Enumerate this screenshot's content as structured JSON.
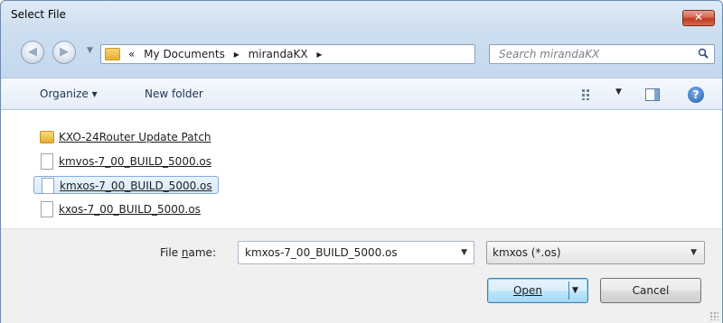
{
  "window": {
    "title": "Select File",
    "close_label": "✕"
  },
  "address_bar": {
    "overflow": "«",
    "crumbs": [
      "My Documents",
      "mirandaKX"
    ],
    "separator": "▸"
  },
  "search": {
    "placeholder": "Search mirandaKX"
  },
  "toolbar": {
    "organize_label": "Organize ▾",
    "new_folder_label": "New folder"
  },
  "files": [
    {
      "name": "KXO-24Router Update Patch",
      "type": "folder",
      "selected": false
    },
    {
      "name": "kmvos-7_00_BUILD_5000.os",
      "type": "file",
      "selected": false
    },
    {
      "name": "kmxos-7_00_BUILD_5000.os",
      "type": "file",
      "selected": true
    },
    {
      "name": "kxos-7_00_BUILD_5000.os",
      "type": "file",
      "selected": false
    }
  ],
  "footer": {
    "file_name_label_pre": "File ",
    "file_name_label_key": "n",
    "file_name_label_post": "ame:",
    "file_name_value": "kmxos-7_00_BUILD_5000.os",
    "file_type_value": "kmxos (*.os)",
    "open_label": "Open",
    "cancel_label": "Cancel"
  },
  "colors": {
    "accent": "#3c7fb1",
    "selection": "#d8e9fb",
    "close": "#c13a22"
  }
}
